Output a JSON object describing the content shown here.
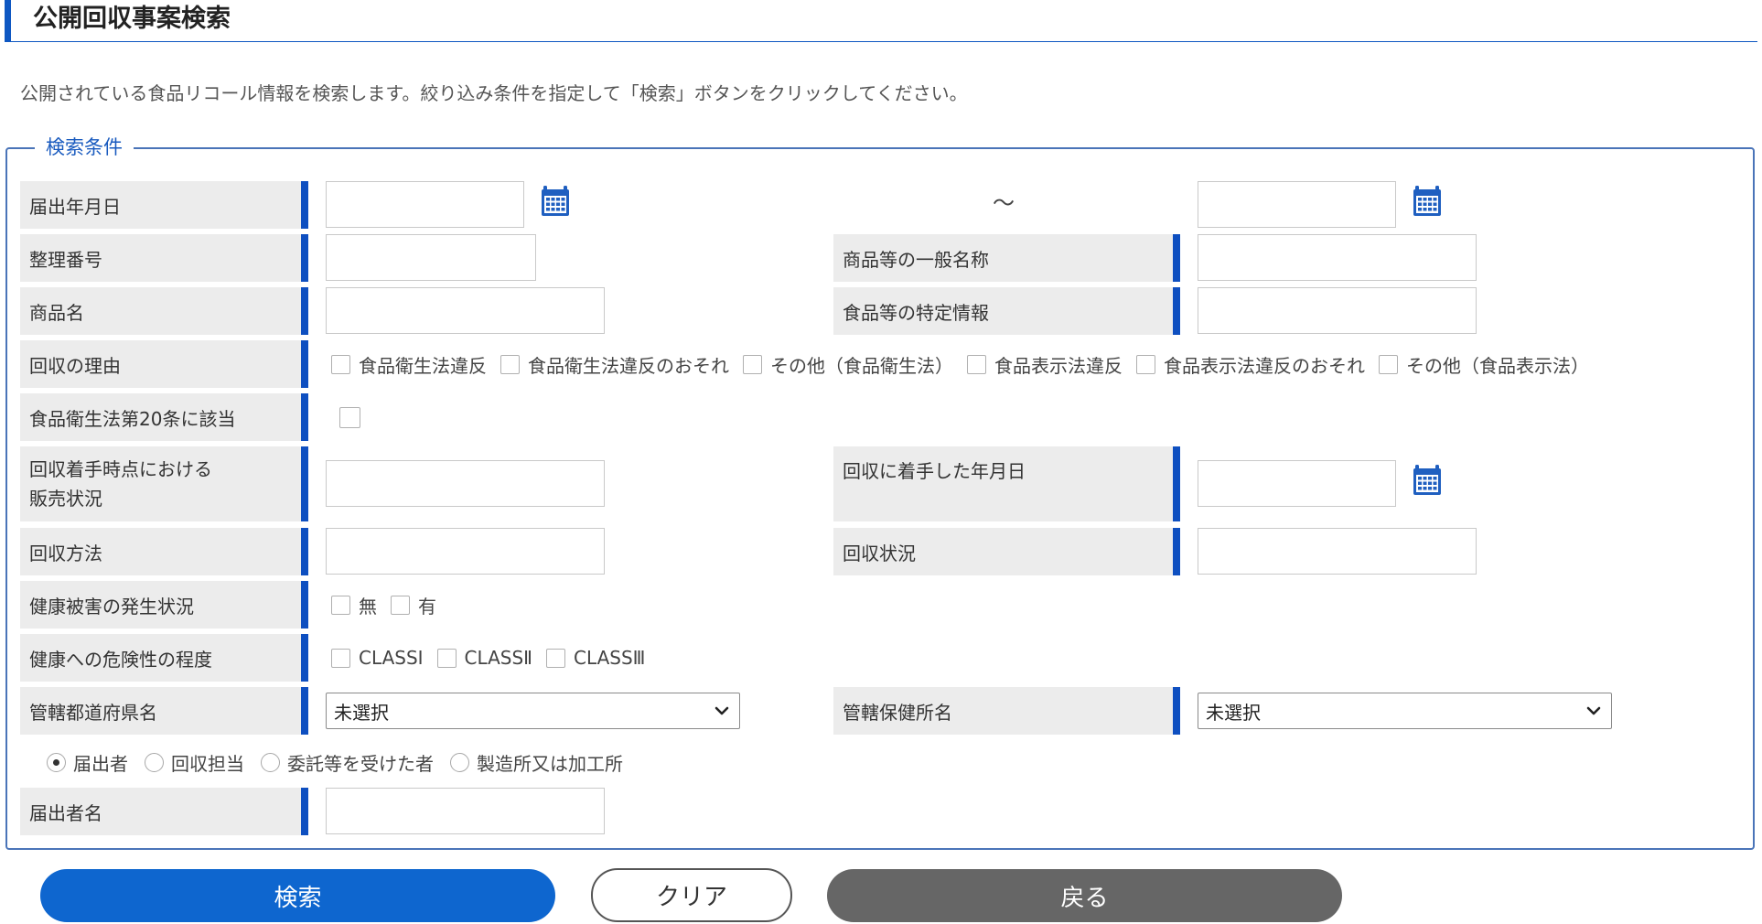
{
  "header": {
    "title": "公開回収事案検索"
  },
  "description": "公開されている食品リコール情報を検索します。絞り込み条件を指定して「検索」ボタンをクリックしてください。",
  "fieldset": {
    "legend": "検索条件",
    "notification_date": {
      "label": "届出年月日",
      "from_value": "",
      "to_value": "",
      "separator": "～"
    },
    "reference_number": {
      "label": "整理番号",
      "value": ""
    },
    "general_name": {
      "label": "商品等の一般名称",
      "value": ""
    },
    "product_name": {
      "label": "商品名",
      "value": ""
    },
    "specific_info": {
      "label": "食品等の特定情報",
      "value": ""
    },
    "recall_reason": {
      "label": "回収の理由",
      "options": [
        {
          "label": "食品衛生法違反",
          "checked": false
        },
        {
          "label": "食品衛生法違反のおそれ",
          "checked": false
        },
        {
          "label": "その他（食品衛生法）",
          "checked": false
        },
        {
          "label": "食品表示法違反",
          "checked": false
        },
        {
          "label": "食品表示法違反のおそれ",
          "checked": false
        },
        {
          "label": "その他（食品表示法）",
          "checked": false
        }
      ]
    },
    "article20": {
      "label": "食品衛生法第20条に該当",
      "checked": false
    },
    "sales_status": {
      "label_line1": "回収着手時点における",
      "label_line2": "販売状況",
      "value": ""
    },
    "recall_start_date": {
      "label": "回収に着手した年月日",
      "value": ""
    },
    "recall_method": {
      "label": "回収方法",
      "value": ""
    },
    "recall_status": {
      "label": "回収状況",
      "value": ""
    },
    "health_damage": {
      "label": "健康被害の発生状況",
      "options": [
        {
          "label": "無",
          "checked": false
        },
        {
          "label": "有",
          "checked": false
        }
      ]
    },
    "risk_level": {
      "label": "健康への危険性の程度",
      "options": [
        {
          "label": "CLASSⅠ",
          "checked": false
        },
        {
          "label": "CLASSⅡ",
          "checked": false
        },
        {
          "label": "CLASSⅢ",
          "checked": false
        }
      ]
    },
    "prefecture": {
      "label": "管轄都道府県名",
      "selected": "未選択"
    },
    "health_center": {
      "label": "管轄保健所名",
      "selected": "未選択"
    },
    "party_type": {
      "options": [
        {
          "label": "届出者",
          "selected": true
        },
        {
          "label": "回収担当",
          "selected": false
        },
        {
          "label": "委託等を受けた者",
          "selected": false
        },
        {
          "label": "製造所又は加工所",
          "selected": false
        }
      ]
    },
    "notifier_name": {
      "label": "届出者名",
      "value": ""
    }
  },
  "buttons": {
    "search": "検索",
    "clear": "クリア",
    "back": "戻る"
  },
  "colors": {
    "accent": "#0e4fc0",
    "primary_button": "#0e66cf",
    "back_button": "#666666",
    "label_background": "#ececec",
    "legend_text": "#1a5bbf"
  },
  "icons": {
    "calendar": "calendar-icon",
    "select_arrow": "chevron-down-icon"
  }
}
